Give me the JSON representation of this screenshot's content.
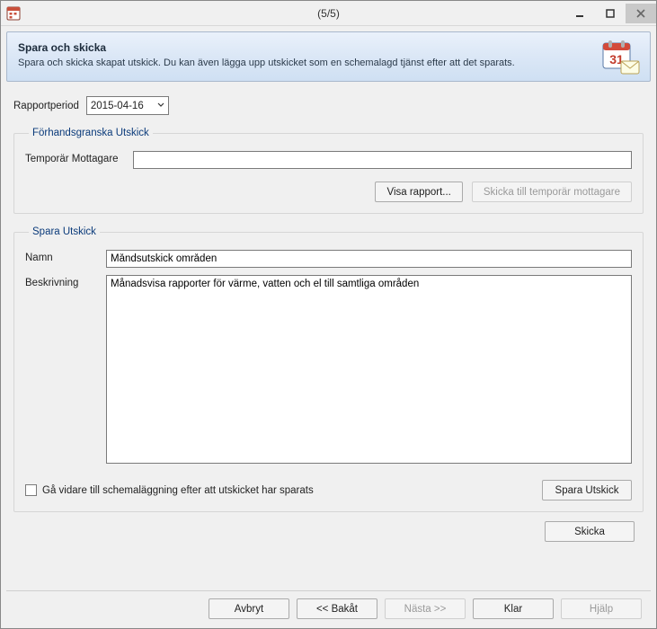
{
  "window": {
    "title": "(5/5)",
    "controls": {
      "minimize": "minimize",
      "maximize": "maximize",
      "close": "close"
    }
  },
  "header": {
    "title": "Spara och skicka",
    "description": "Spara och skicka skapat utskick. Du kan även lägga upp utskicket som en schemalagd tjänst efter att det sparats."
  },
  "report_period": {
    "label": "Rapportperiod",
    "value": "2015-04-16"
  },
  "preview_group": {
    "legend": "Förhandsgranska Utskick",
    "temp_recipient_label": "Temporär Mottagare",
    "temp_recipient_value": "",
    "show_report_button": "Visa rapport...",
    "send_temp_button": "Skicka till temporär mottagare"
  },
  "save_group": {
    "legend": "Spara Utskick",
    "name_label": "Namn",
    "name_value": "Måndsutskick områden",
    "description_label": "Beskrivning",
    "description_value": "Månadsvisa rapporter för värme, vatten och el till samtliga områden",
    "checkbox_label": "Gå vidare till schemaläggning efter att utskicket har sparats",
    "checkbox_checked": false,
    "save_button": "Spara Utskick"
  },
  "send_button": "Skicka",
  "footer": {
    "cancel": "Avbryt",
    "back": "<< Bakåt",
    "next": "Nästa >>",
    "finish": "Klar",
    "help": "Hjälp"
  }
}
